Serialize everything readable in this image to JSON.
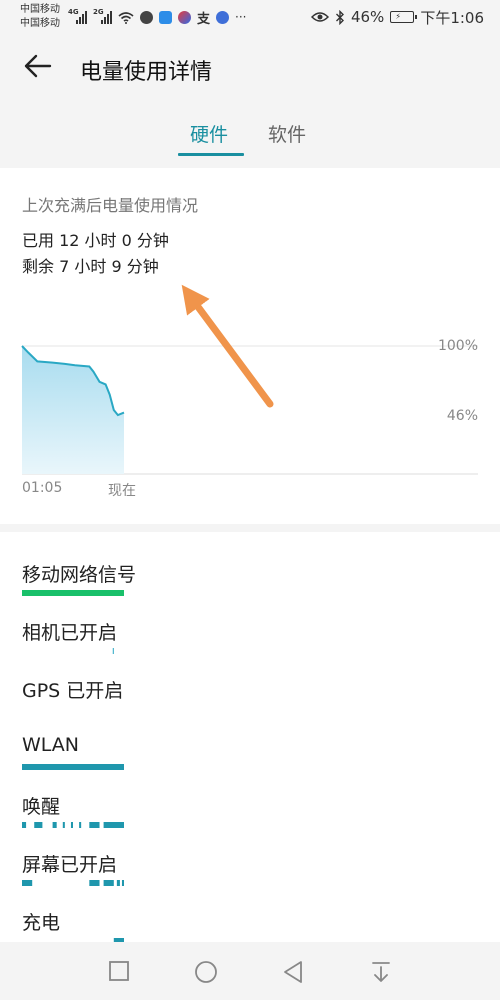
{
  "status_bar": {
    "carrier_1": "中国移动",
    "carrier_2": "中国移动",
    "network_1": "4G",
    "network_2": "2G",
    "more": "···",
    "battery_percent": "46%",
    "time": "下午1:06"
  },
  "header": {
    "title": "电量使用详情"
  },
  "tabs": [
    {
      "label": "硬件",
      "active": true
    },
    {
      "label": "软件",
      "active": false
    }
  ],
  "usage_card": {
    "title": "上次充满后电量使用情况",
    "used": "已用 12 小时 0 分钟",
    "remaining": "剩余 7 小时 9 分钟"
  },
  "chart_data": {
    "type": "area",
    "x_tick_labels": [
      "01:05",
      "现在"
    ],
    "y_tick_labels": [
      "100%",
      "46%"
    ],
    "ylim": [
      0,
      100
    ],
    "x": [
      0,
      0.06,
      0.15,
      0.3,
      0.42,
      0.52,
      0.66,
      0.7,
      0.76,
      0.82,
      0.86,
      0.9,
      0.94,
      1.0
    ],
    "series": [
      {
        "values": [
          100,
          95,
          88,
          87,
          86,
          85,
          84,
          80,
          72,
          70,
          62,
          50,
          46,
          48
        ]
      }
    ],
    "colors": {
      "line": "#2aa8c4",
      "fill_top": "#a8dcef",
      "fill_bottom": "#e9f6fb",
      "grid": "#e2e2e2"
    },
    "annotation": "orange-arrow"
  },
  "hardware_rows": [
    {
      "label": "移动网络信号",
      "bar_color": "#19c06a",
      "segments": [
        [
          0,
          1
        ]
      ]
    },
    {
      "label": "相机已开启",
      "bar_color": "#2aa8c4",
      "segments": [
        [
          0.89,
          0.9
        ]
      ]
    },
    {
      "label": "GPS 已开启",
      "bar_color": "#2aa8c4",
      "segments": []
    },
    {
      "label": "WLAN",
      "bar_color": "#1f97ad",
      "segments": [
        [
          0,
          1
        ]
      ]
    },
    {
      "label": "唤醒",
      "bar_color": "#1f97ad",
      "segments": [
        [
          0,
          0.04
        ],
        [
          0.12,
          0.2
        ],
        [
          0.3,
          0.34
        ],
        [
          0.4,
          0.42
        ],
        [
          0.48,
          0.5
        ],
        [
          0.56,
          0.58
        ],
        [
          0.66,
          0.76
        ],
        [
          0.8,
          1.0
        ]
      ]
    },
    {
      "label": "屏幕已开启",
      "bar_color": "#1f97ad",
      "segments": [
        [
          0,
          0.1
        ],
        [
          0.66,
          0.76
        ],
        [
          0.8,
          0.9
        ],
        [
          0.93,
          0.96
        ],
        [
          0.98,
          1.0
        ]
      ]
    },
    {
      "label": "充电",
      "bar_color": "#1f97ad",
      "segments": [
        [
          0.9,
          1.0
        ]
      ]
    }
  ]
}
